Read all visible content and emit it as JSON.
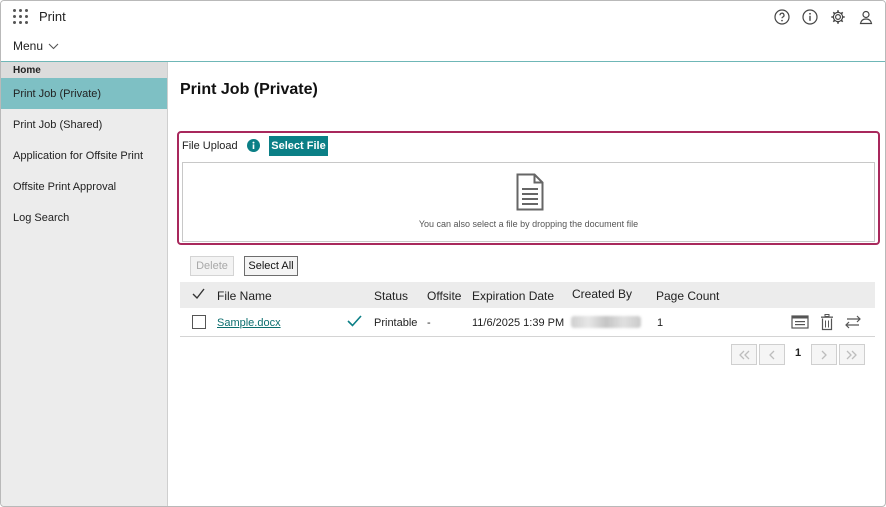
{
  "app": {
    "title": "Print",
    "menu_label": "Menu"
  },
  "header": {
    "icons": [
      "help-icon",
      "info-icon",
      "gear-icon",
      "user-icon"
    ]
  },
  "sidebar": {
    "home_label": "Home",
    "items": [
      {
        "label": "Print Job (Private)",
        "active": true
      },
      {
        "label": "Print Job (Shared)",
        "active": false
      },
      {
        "label": "Application for Offsite Print",
        "active": false
      },
      {
        "label": "Offsite Print Approval",
        "active": false
      },
      {
        "label": "Log Search",
        "active": false
      }
    ]
  },
  "main": {
    "title": "Print Job (Private)",
    "upload": {
      "label": "File Upload",
      "select_file_label": "Select File",
      "drop_hint": "You can also select a file by dropping the document file"
    },
    "toolbar": {
      "delete_label": "Delete",
      "select_all_label": "Select All"
    },
    "table": {
      "columns": [
        "File Name",
        "Status",
        "Offsite",
        "Expiration Date",
        "Created By",
        "Page Count"
      ],
      "rows": [
        {
          "file_name": "Sample.docx",
          "status": "Printable",
          "offsite": "-",
          "expiration": "11/6/2025 1:39 PM",
          "created_by": "",
          "page_count": "1"
        }
      ]
    },
    "pagination": {
      "current_page": "1"
    }
  },
  "colors": {
    "accent": "#0b7f86",
    "active_nav": "#7ec0c4",
    "upload_border": "#a8285c",
    "link": "#0b6e6e"
  }
}
